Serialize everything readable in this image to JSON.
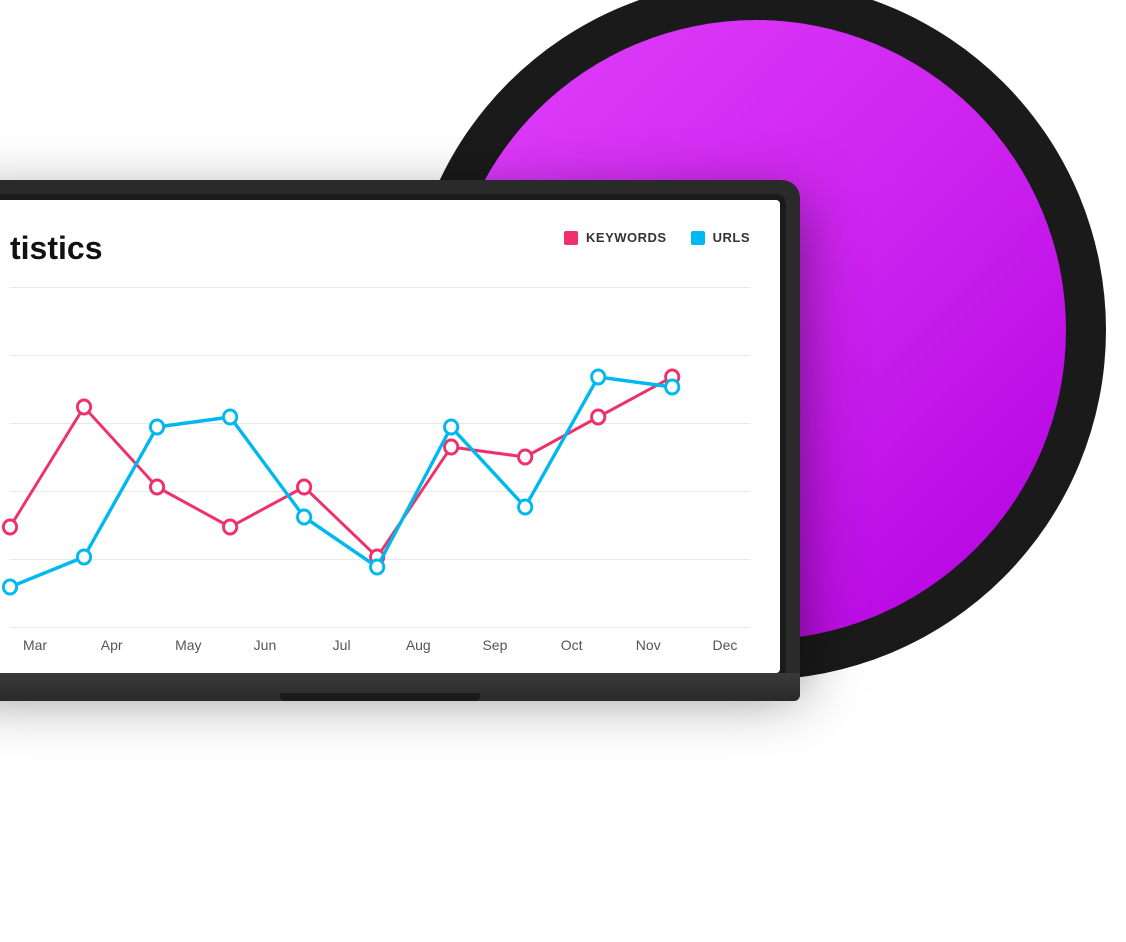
{
  "chart": {
    "title": "tistics",
    "legend": {
      "keywords_label": "KEYWORDS",
      "urls_label": "URLS"
    },
    "x_axis": [
      "Mar",
      "Apr",
      "May",
      "Jun",
      "Jul",
      "Aug",
      "Sep",
      "Oct",
      "Nov",
      "Dec"
    ],
    "colors": {
      "keywords": "#f0306a",
      "urls": "#00b8f0",
      "background": "#ffffff",
      "grid": "#e8e8e8"
    }
  },
  "decorative": {
    "circle_color_inner": "#cc22ee",
    "circle_color_outer": "#1a1a1a"
  }
}
